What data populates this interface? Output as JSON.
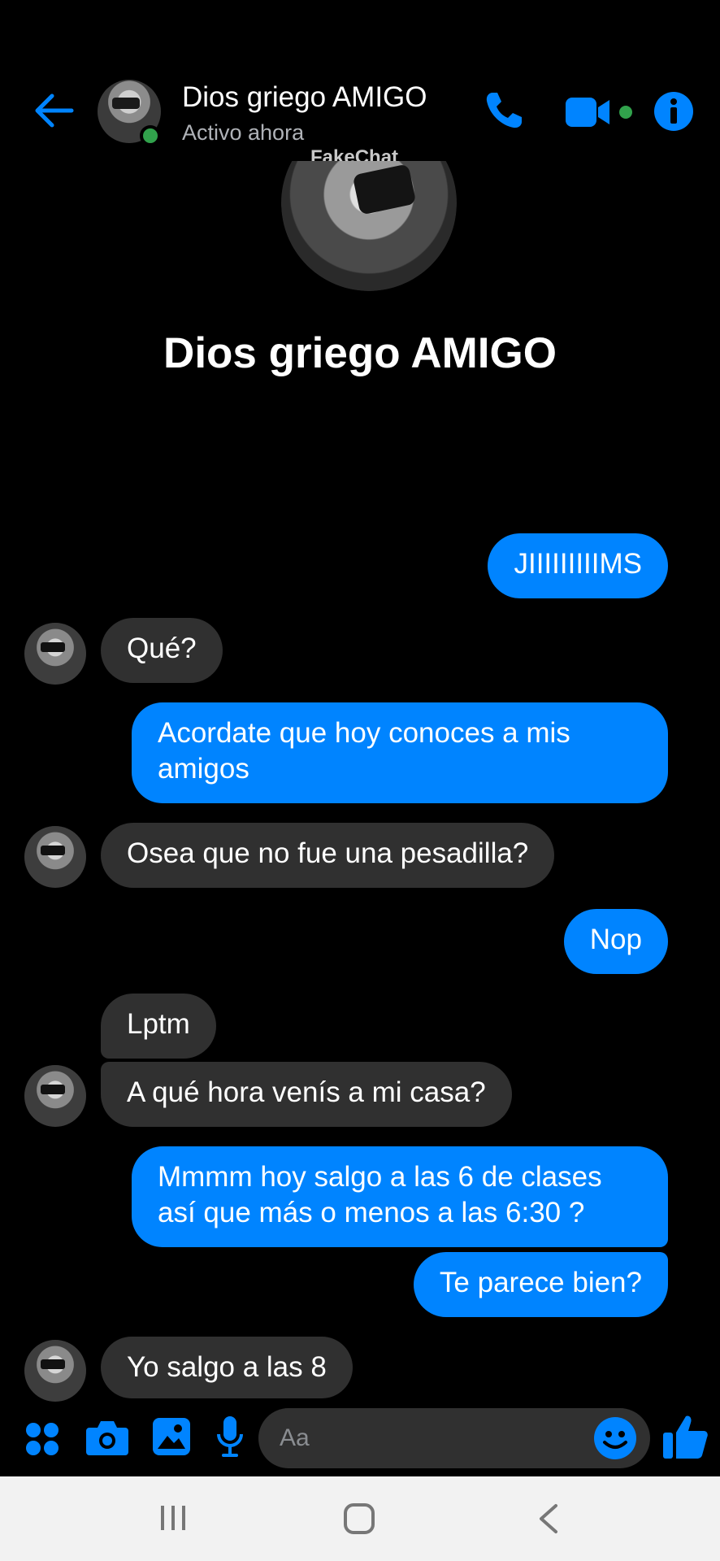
{
  "header": {
    "contact_name": "Dios griego AMIGO",
    "status": "Activo ahora",
    "watermark": "FakeChat"
  },
  "profile": {
    "name": "Dios griego AMIGO"
  },
  "colors": {
    "accent": "#0084ff",
    "incoming_bubble": "#303030",
    "online": "#31a24c"
  },
  "messages": [
    {
      "from": "me",
      "text": "JIIIIIIIIIMS"
    },
    {
      "from": "them",
      "text": "Qué?"
    },
    {
      "from": "me",
      "text": "Acordate que hoy conoces a mis amigos"
    },
    {
      "from": "them",
      "text": "Osea que no fue una pesadilla?"
    },
    {
      "from": "me",
      "text": "Nop"
    },
    {
      "from": "them",
      "text": "Lptm"
    },
    {
      "from": "them",
      "text": "A qué hora venís a mi casa?"
    },
    {
      "from": "me",
      "text": "Mmmm hoy salgo a las 6 de clases así que más o menos a las 6:30 ?"
    },
    {
      "from": "me",
      "text": "Te parece bien?"
    },
    {
      "from": "them",
      "text": "Yo salgo a las 8"
    }
  ],
  "composer": {
    "placeholder": "Aa"
  },
  "icons": [
    "back-arrow-icon",
    "phone-icon",
    "video-camera-icon",
    "info-icon",
    "apps-icon",
    "camera-icon",
    "gallery-icon",
    "microphone-icon",
    "emoji-icon",
    "thumbs-up-icon",
    "recent-apps-icon",
    "home-icon",
    "nav-back-icon"
  ]
}
